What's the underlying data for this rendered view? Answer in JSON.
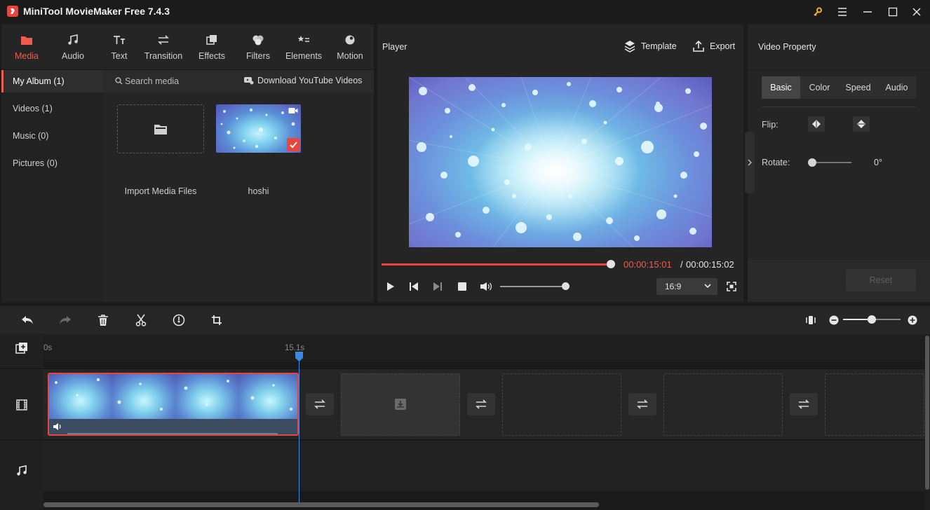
{
  "app": {
    "title": "MiniTool MovieMaker Free 7.4.3",
    "accent_color": "#e8453c"
  },
  "toolbar": {
    "tabs": [
      {
        "label": "Media",
        "icon": "folder-icon",
        "active": true
      },
      {
        "label": "Audio",
        "icon": "music-note-icon"
      },
      {
        "label": "Text",
        "icon": "text-icon"
      },
      {
        "label": "Transition",
        "icon": "transition-arrows-icon"
      },
      {
        "label": "Effects",
        "icon": "effects-icon"
      },
      {
        "label": "Filters",
        "icon": "filters-icon"
      },
      {
        "label": "Elements",
        "icon": "elements-icon"
      },
      {
        "label": "Motion",
        "icon": "motion-icon"
      }
    ]
  },
  "media": {
    "nav": [
      {
        "label": "My Album (1)",
        "active": true
      },
      {
        "label": "Videos (1)"
      },
      {
        "label": "Music (0)"
      },
      {
        "label": "Pictures (0)"
      }
    ],
    "search_placeholder": "Search media",
    "download_label": "Download YouTube Videos",
    "import_label": "Import Media Files",
    "clip_name": "hoshi"
  },
  "player": {
    "title": "Player",
    "template_label": "Template",
    "export_label": "Export",
    "time_current": "00:00:15:01",
    "time_separator": "/",
    "time_total": "00:00:15:02",
    "progress": 1.0,
    "volume": 0.95,
    "aspect_ratio": "16:9"
  },
  "property": {
    "title": "Video Property",
    "tabs": [
      {
        "label": "Basic",
        "active": true
      },
      {
        "label": "Color"
      },
      {
        "label": "Speed"
      },
      {
        "label": "Audio"
      }
    ],
    "flip_label": "Flip:",
    "rotate_label": "Rotate:",
    "rotate_value": "0°",
    "reset_label": "Reset"
  },
  "timeline": {
    "ruler_start": "0s",
    "playhead_time": "15.1s",
    "zoom_level": 0.5
  }
}
